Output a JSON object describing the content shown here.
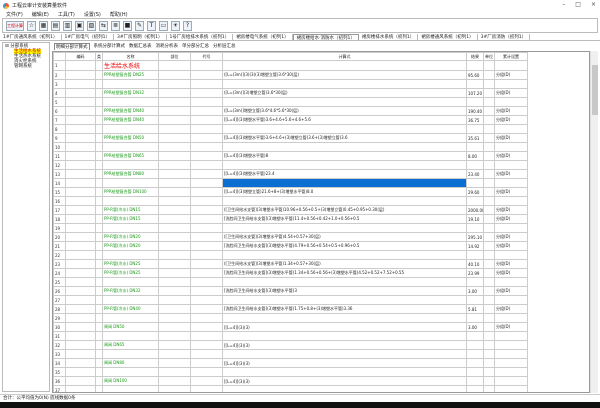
{
  "window": {
    "title": "工程云审计安装算量软件",
    "min": "–",
    "max": "□",
    "close": "×"
  },
  "menu": [
    "文件(F)",
    "编辑(E)",
    "工具(T)",
    "设置(S)",
    "帮助(H)"
  ],
  "toolbar": {
    "calc_label": "工程计算",
    "icons": [
      "star-icon",
      "grid-icon",
      "table-icon",
      "chart-icon",
      "calendar-icon",
      "calculator-icon",
      "split-icon",
      "layers-icon",
      "export-icon",
      "pen-icon",
      "text-icon",
      "note-icon",
      "light-icon",
      "help-icon"
    ]
  },
  "tabs": [
    "1#厂房通风系统（初列1）",
    "1#厂房电气（初列1）",
    "3#厂房照明（初列1）",
    "1号厂房给排水系统（初列1）",
    "裙房楼电气系统（初列1）",
    "裙房楼给水·消防水（初列1）",
    "裙房楼排水系统（初列1）",
    "裙房楼通风系统（初列1）",
    "3#厂房消防（初列1）"
  ],
  "active_tab": 5,
  "tree": {
    "root": "分部系统",
    "children": [
      "生活给水系统",
      "生活热水系统",
      "消火栓系统",
      "管网系统"
    ],
    "selected": 0
  },
  "subtabs": [
    "明细分部计算式",
    "系统分部计算式",
    "数据汇总表",
    "消耗分析表",
    "单分部分汇总",
    "分析层汇总"
  ],
  "columns": [
    "",
    "编码",
    "类",
    "名称",
    "部位",
    "代号",
    "计算式",
    "结果",
    "单位",
    "累计设置"
  ],
  "rows": [
    {
      "n": "1",
      "name": "生活给水系统",
      "header": true
    },
    {
      "n": "2",
      "name": "PPR给塑复合管 DN25",
      "formula": "([L=(3m)](3)(3)(3)增塑立管)3.6*30(层)",
      "result": "95.60",
      "acc": "分组(D)"
    },
    {
      "n": "3"
    },
    {
      "n": "4",
      "name": "PPR给塑复合管 DN32",
      "formula": "([L=(3m)](3)增塑立管)3.6*30(层)",
      "result": "107.20",
      "acc": "分组(D)"
    },
    {
      "n": "5"
    },
    {
      "n": "6",
      "name": "PPR给塑复合管 DN40",
      "formula": "([L=(3m)]增塑立管)3.6*4.6*5.6*30(层)",
      "result": "190.40",
      "acc": "分组(D)"
    },
    {
      "n": "7",
      "name": "PPR给塑复合管 DN40",
      "formula": "[[L=4]](3)增塑水平管)3.6+4.6+5.6+4.6+5.6",
      "result": "36.75",
      "acc": "分组(D)"
    },
    {
      "n": "8"
    },
    {
      "n": "9",
      "name": "PPR给塑复合管 DN50",
      "formula": "[[L=4]](3)增塑水平管)3.6+4.6+(3)增塑立管)3.6+(3)增塑立管)3.6",
      "result": "35.61",
      "acc": "分组(D)"
    },
    {
      "n": "10"
    },
    {
      "n": "11",
      "name": "PPR给塑复合管 DN65",
      "formula": "[[L=4]](3)增塑水平管)8",
      "result": "8.00",
      "acc": "分组(D)"
    },
    {
      "n": "12"
    },
    {
      "n": "13",
      "name": "PPR给塑复合管 DN80",
      "formula": "[[L=4]](3)增塑水平管)23.4",
      "result": "23.40",
      "acc": "分组(D)"
    },
    {
      "n": "14",
      "selected": true
    },
    {
      "n": "15",
      "name": "PPR给塑复合管 DN100",
      "formula": "[[L=4]](3)增塑立管)21.6+8+(3)增塑水平管)8.0",
      "result": "29.60",
      "acc": "分组(D)"
    },
    {
      "n": "16"
    },
    {
      "n": "17",
      "name": "PP-R管(冷水) DN15",
      "formula": "([卫生间给水支管](3)增塑水平管)10.96+0.56+0.5+(3)增塑立管)0.45+0.95+0.30(层)",
      "result": "2000.00",
      "acc": "分组(D)"
    },
    {
      "n": "18",
      "name": "PP-R管(冷水) DN15",
      "formula": "[洗脸间卫生间给水支管](3)增塑水平管)11.4+0.56+0.42+1.0+0.56+0.5",
      "result": "19.10",
      "acc": "分组(D)"
    },
    {
      "n": "19"
    },
    {
      "n": "20",
      "name": "PP-R管(冷水) DN20",
      "formula": "([卫生间给水支管](3)增塑水平管)4.54+0.57+30(层)",
      "result": "295.10",
      "acc": "分组(D)"
    },
    {
      "n": "21",
      "name": "PP-R管(冷水) DN20",
      "formula": "[洗脸间卫生间给水支管](3)增塑水平管)4.79+0.56+0.54+0.5+0.96+0.5",
      "result": "14.92",
      "acc": "分组(D)"
    },
    {
      "n": "22"
    },
    {
      "n": "23",
      "name": "PP-R管(冷水) DN25",
      "formula": "([卫生间给水支管](3)增塑水平管)1.34+0.57+30(层)",
      "result": "40.10",
      "acc": "分组(D)"
    },
    {
      "n": "24",
      "name": "PP-R管(冷水) DN25",
      "formula": "[洗脸间卫生间给水支管](3)增塑水平管)1.34+0.56+0.56+(3)增塑水平管)4.52+0.52+7.52+0.55",
      "result": "23.99",
      "acc": "分组(D)"
    },
    {
      "n": "25"
    },
    {
      "n": "26",
      "name": "PP-R管(冷水) DN32",
      "formula": "[洗脸间卫生间给水支管](3)增塑水平管)3",
      "result": "3.00",
      "acc": "分组(D)"
    },
    {
      "n": "27"
    },
    {
      "n": "28",
      "name": "PP-R管(冷水) DN40",
      "formula": "[洗脸间卫生间给水支管](3)增塑水平管)1.75+0.8+(3)增塑水平管)3.36",
      "result": "5.81",
      "acc": "分组(D)"
    },
    {
      "n": "29"
    },
    {
      "n": "30",
      "name": "闸阀 DN50",
      "formula": "[[L=4]](3)(3)",
      "result": "3.00",
      "acc": "分组(D)"
    },
    {
      "n": "31"
    },
    {
      "n": "32",
      "name": "闸阀 DN65",
      "formula": "[[L=4]](3)(3)",
      "result": "",
      "acc": ""
    },
    {
      "n": "33"
    },
    {
      "n": "34",
      "name": "闸阀 DN80",
      "formula": "[[L=4]](3)(3)",
      "result": "",
      "acc": ""
    },
    {
      "n": "35"
    },
    {
      "n": "36",
      "name": "闸阀 DN100",
      "formula": "[[L=4]](3)(3)",
      "result": "",
      "acc": ""
    },
    {
      "n": "37"
    }
  ],
  "status": "合计：公平均值为0(N) 底线数据0条"
}
